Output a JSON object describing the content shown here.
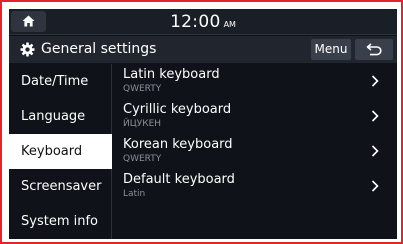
{
  "status": {
    "time": "12:00",
    "ampm": "AM"
  },
  "header": {
    "title": "General settings",
    "menu_label": "Menu"
  },
  "sidebar": {
    "items": [
      {
        "label": "Date/Time",
        "active": false
      },
      {
        "label": "Language",
        "active": false
      },
      {
        "label": "Keyboard",
        "active": true
      },
      {
        "label": "Screensaver",
        "active": false
      },
      {
        "label": "System info",
        "active": false
      }
    ]
  },
  "keyboard_list": {
    "items": [
      {
        "title": "Latin keyboard",
        "value": "QWERTY"
      },
      {
        "title": "Cyrillic keyboard",
        "value": "ЙЦУКЕН"
      },
      {
        "title": "Korean keyboard",
        "value": "QWERTY"
      },
      {
        "title": "Default keyboard",
        "value": "Latin"
      }
    ]
  },
  "icons": {
    "home": "home-icon",
    "settings": "gear-icon",
    "back": "back-arrow-icon",
    "row_arrow": "chevron-right-icon"
  },
  "colors": {
    "frame_border": "#e0262a",
    "screen_bg": "#0f1218",
    "active_tab_bg": "#ffffff",
    "button_bg": "#3a404b",
    "secondary_text": "#8a8f98"
  }
}
